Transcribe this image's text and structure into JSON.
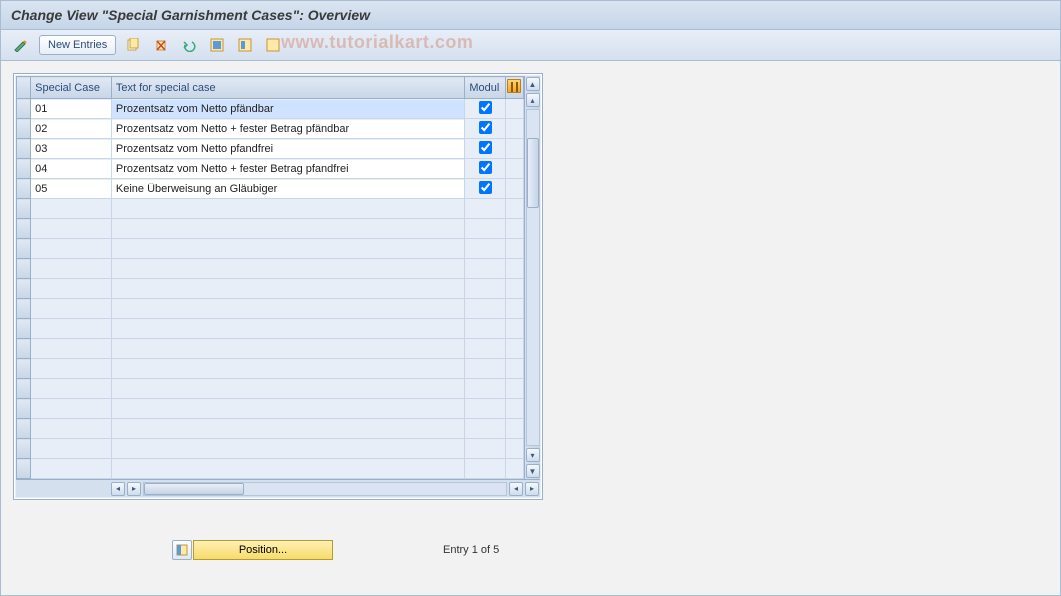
{
  "title": "Change View \"Special Garnishment Cases\": Overview",
  "watermark": "www.tutorialkart.com",
  "toolbar": {
    "new_entries": "New Entries"
  },
  "columns": {
    "special_case": "Special Case",
    "text": "Text for special case",
    "modul": "Modul"
  },
  "rows": [
    {
      "code": "01",
      "text": "Prozentsatz vom Netto pfändbar",
      "checked": true,
      "selected": true
    },
    {
      "code": "02",
      "text": "Prozentsatz vom Netto + fester Betrag pfändbar",
      "checked": true,
      "selected": false
    },
    {
      "code": "03",
      "text": "Prozentsatz vom Netto pfandfrei",
      "checked": true,
      "selected": false
    },
    {
      "code": "04",
      "text": "Prozentsatz vom Netto + fester Betrag pfandfrei",
      "checked": true,
      "selected": false
    },
    {
      "code": "05",
      "text": "Keine Überweisung an Gläubiger",
      "checked": true,
      "selected": false
    }
  ],
  "empty_rows": 14,
  "footer": {
    "position": "Position...",
    "entry_info": "Entry 1 of 5"
  }
}
